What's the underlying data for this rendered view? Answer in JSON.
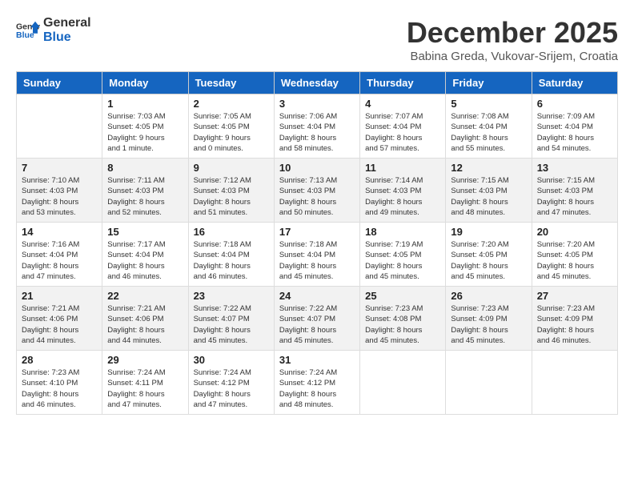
{
  "header": {
    "logo_general": "General",
    "logo_blue": "Blue",
    "title": "December 2025",
    "subtitle": "Babina Greda, Vukovar-Srijem, Croatia"
  },
  "days_of_week": [
    "Sunday",
    "Monday",
    "Tuesday",
    "Wednesday",
    "Thursday",
    "Friday",
    "Saturday"
  ],
  "weeks": [
    [
      {
        "day": "",
        "info": ""
      },
      {
        "day": "1",
        "info": "Sunrise: 7:03 AM\nSunset: 4:05 PM\nDaylight: 9 hours\nand 1 minute."
      },
      {
        "day": "2",
        "info": "Sunrise: 7:05 AM\nSunset: 4:05 PM\nDaylight: 9 hours\nand 0 minutes."
      },
      {
        "day": "3",
        "info": "Sunrise: 7:06 AM\nSunset: 4:04 PM\nDaylight: 8 hours\nand 58 minutes."
      },
      {
        "day": "4",
        "info": "Sunrise: 7:07 AM\nSunset: 4:04 PM\nDaylight: 8 hours\nand 57 minutes."
      },
      {
        "day": "5",
        "info": "Sunrise: 7:08 AM\nSunset: 4:04 PM\nDaylight: 8 hours\nand 55 minutes."
      },
      {
        "day": "6",
        "info": "Sunrise: 7:09 AM\nSunset: 4:04 PM\nDaylight: 8 hours\nand 54 minutes."
      }
    ],
    [
      {
        "day": "7",
        "info": "Sunrise: 7:10 AM\nSunset: 4:03 PM\nDaylight: 8 hours\nand 53 minutes."
      },
      {
        "day": "8",
        "info": "Sunrise: 7:11 AM\nSunset: 4:03 PM\nDaylight: 8 hours\nand 52 minutes."
      },
      {
        "day": "9",
        "info": "Sunrise: 7:12 AM\nSunset: 4:03 PM\nDaylight: 8 hours\nand 51 minutes."
      },
      {
        "day": "10",
        "info": "Sunrise: 7:13 AM\nSunset: 4:03 PM\nDaylight: 8 hours\nand 50 minutes."
      },
      {
        "day": "11",
        "info": "Sunrise: 7:14 AM\nSunset: 4:03 PM\nDaylight: 8 hours\nand 49 minutes."
      },
      {
        "day": "12",
        "info": "Sunrise: 7:15 AM\nSunset: 4:03 PM\nDaylight: 8 hours\nand 48 minutes."
      },
      {
        "day": "13",
        "info": "Sunrise: 7:15 AM\nSunset: 4:03 PM\nDaylight: 8 hours\nand 47 minutes."
      }
    ],
    [
      {
        "day": "14",
        "info": "Sunrise: 7:16 AM\nSunset: 4:04 PM\nDaylight: 8 hours\nand 47 minutes."
      },
      {
        "day": "15",
        "info": "Sunrise: 7:17 AM\nSunset: 4:04 PM\nDaylight: 8 hours\nand 46 minutes."
      },
      {
        "day": "16",
        "info": "Sunrise: 7:18 AM\nSunset: 4:04 PM\nDaylight: 8 hours\nand 46 minutes."
      },
      {
        "day": "17",
        "info": "Sunrise: 7:18 AM\nSunset: 4:04 PM\nDaylight: 8 hours\nand 45 minutes."
      },
      {
        "day": "18",
        "info": "Sunrise: 7:19 AM\nSunset: 4:05 PM\nDaylight: 8 hours\nand 45 minutes."
      },
      {
        "day": "19",
        "info": "Sunrise: 7:20 AM\nSunset: 4:05 PM\nDaylight: 8 hours\nand 45 minutes."
      },
      {
        "day": "20",
        "info": "Sunrise: 7:20 AM\nSunset: 4:05 PM\nDaylight: 8 hours\nand 45 minutes."
      }
    ],
    [
      {
        "day": "21",
        "info": "Sunrise: 7:21 AM\nSunset: 4:06 PM\nDaylight: 8 hours\nand 44 minutes."
      },
      {
        "day": "22",
        "info": "Sunrise: 7:21 AM\nSunset: 4:06 PM\nDaylight: 8 hours\nand 44 minutes."
      },
      {
        "day": "23",
        "info": "Sunrise: 7:22 AM\nSunset: 4:07 PM\nDaylight: 8 hours\nand 45 minutes."
      },
      {
        "day": "24",
        "info": "Sunrise: 7:22 AM\nSunset: 4:07 PM\nDaylight: 8 hours\nand 45 minutes."
      },
      {
        "day": "25",
        "info": "Sunrise: 7:23 AM\nSunset: 4:08 PM\nDaylight: 8 hours\nand 45 minutes."
      },
      {
        "day": "26",
        "info": "Sunrise: 7:23 AM\nSunset: 4:09 PM\nDaylight: 8 hours\nand 45 minutes."
      },
      {
        "day": "27",
        "info": "Sunrise: 7:23 AM\nSunset: 4:09 PM\nDaylight: 8 hours\nand 46 minutes."
      }
    ],
    [
      {
        "day": "28",
        "info": "Sunrise: 7:23 AM\nSunset: 4:10 PM\nDaylight: 8 hours\nand 46 minutes."
      },
      {
        "day": "29",
        "info": "Sunrise: 7:24 AM\nSunset: 4:11 PM\nDaylight: 8 hours\nand 47 minutes."
      },
      {
        "day": "30",
        "info": "Sunrise: 7:24 AM\nSunset: 4:12 PM\nDaylight: 8 hours\nand 47 minutes."
      },
      {
        "day": "31",
        "info": "Sunrise: 7:24 AM\nSunset: 4:12 PM\nDaylight: 8 hours\nand 48 minutes."
      },
      {
        "day": "",
        "info": ""
      },
      {
        "day": "",
        "info": ""
      },
      {
        "day": "",
        "info": ""
      }
    ]
  ]
}
